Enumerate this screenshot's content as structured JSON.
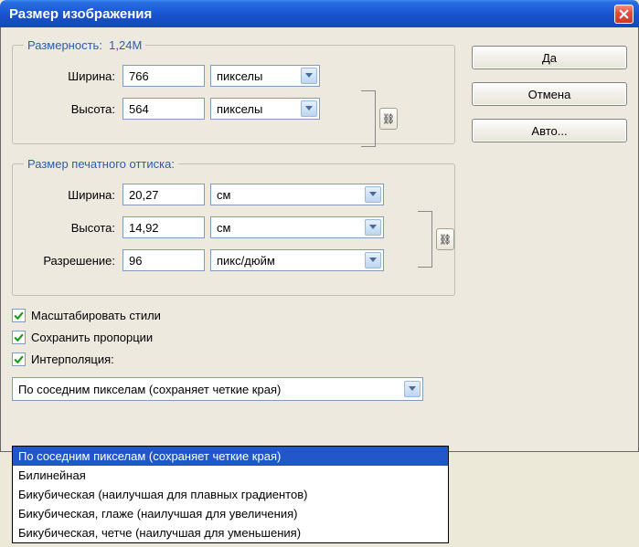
{
  "title": "Размер изображения",
  "buttons": {
    "ok": "Да",
    "cancel": "Отмена",
    "auto": "Авто..."
  },
  "dim": {
    "legend_prefix": "Размерность:",
    "size_text": "1,24M",
    "width_label": "Ширина:",
    "width_value": "766",
    "width_unit": "пикселы",
    "height_label": "Высота:",
    "height_value": "564",
    "height_unit": "пикселы"
  },
  "print": {
    "legend": "Размер печатного оттиска:",
    "width_label": "Ширина:",
    "width_value": "20,27",
    "width_unit": "см",
    "height_label": "Высота:",
    "height_value": "14,92",
    "height_unit": "см",
    "res_label": "Разрешение:",
    "res_value": "96",
    "res_unit": "пикс/дюйм"
  },
  "checks": {
    "scale_styles": "Масштабировать стили",
    "constrain": "Сохранить пропорции",
    "interp": "Интерполяция:"
  },
  "interp_selected": "По соседним пикселам (сохраняет четкие края)",
  "interp_options": [
    "По соседним пикселам (сохраняет четкие края)",
    "Билинейная",
    "Бикубическая (наилучшая для плавных градиентов)",
    "Бикубическая, глаже (наилучшая для увеличения)",
    "Бикубическая, четче (наилучшая для уменьшения)"
  ],
  "link_glyph": "⛓"
}
